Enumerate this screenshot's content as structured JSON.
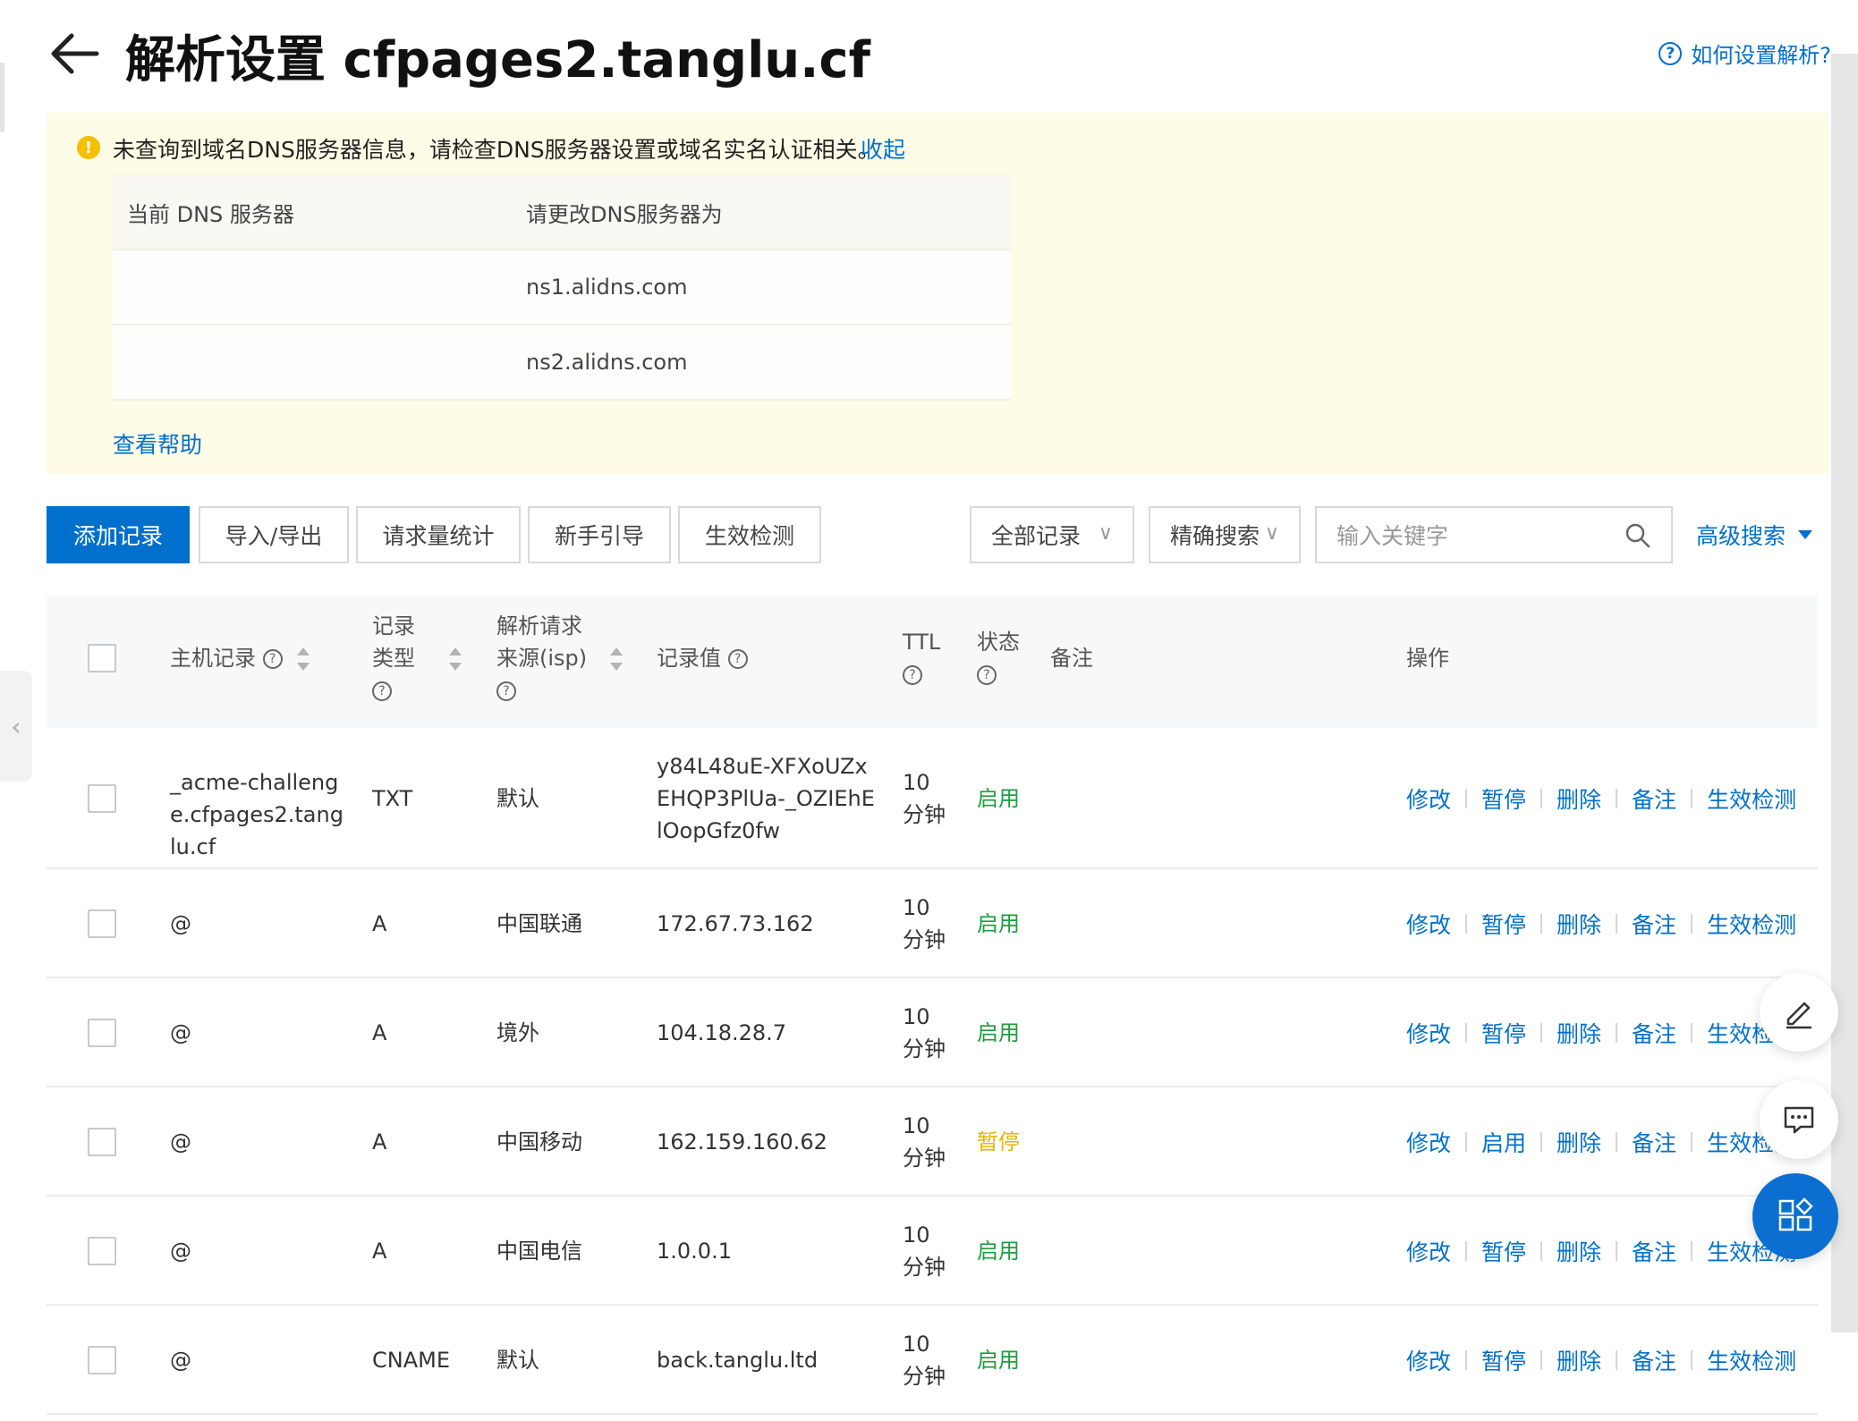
{
  "header": {
    "title": "解析设置 cfpages2.tanglu.cf",
    "help_link": "如何设置解析?"
  },
  "notice": {
    "message": "未查询到域名DNS服务器信息，请检查DNS服务器设置或域名实名认证相关。",
    "collapse": "收起",
    "table_headers": [
      "当前 DNS 服务器",
      "请更改DNS服务器为"
    ],
    "rows": [
      {
        "current": "",
        "target": "ns1.alidns.com"
      },
      {
        "current": "",
        "target": "ns2.alidns.com"
      }
    ],
    "help": "查看帮助"
  },
  "toolbar": {
    "add_record": "添加记录",
    "import_export": "导入/导出",
    "request_stats": "请求量统计",
    "guide": "新手引导",
    "effect_check": "生效检测",
    "record_filter": "全部记录",
    "search_mode": "精确搜索",
    "search_placeholder": "输入关键字",
    "advanced_search": "高级搜索"
  },
  "table": {
    "headers": {
      "host": "主机记录",
      "type_line1": "记录",
      "type_line2": "类型",
      "isp_line1": "解析请求",
      "isp_line2": "来源(isp)",
      "value": "记录值",
      "ttl": "TTL",
      "status": "状态",
      "note": "备注",
      "ops": "操作"
    },
    "rows": [
      {
        "host": "_acme-challenge.cfpages2.tanglu.cf",
        "type": "TXT",
        "isp": "默认",
        "value": "y84L48uE-XFXoUZxEHQP3PlUa-_OZIEhElOopGfz0fw",
        "ttl_value": "10",
        "ttl_unit": "分钟",
        "status": "启用",
        "status_kind": "on",
        "ops": [
          "修改",
          "暂停",
          "删除",
          "备注",
          "生效检测"
        ]
      },
      {
        "host": "@",
        "type": "A",
        "isp": "中国联通",
        "value": "172.67.73.162",
        "ttl_value": "10",
        "ttl_unit": "分钟",
        "status": "启用",
        "status_kind": "on",
        "ops": [
          "修改",
          "暂停",
          "删除",
          "备注",
          "生效检测"
        ]
      },
      {
        "host": "@",
        "type": "A",
        "isp": "境外",
        "value": "104.18.28.7",
        "ttl_value": "10",
        "ttl_unit": "分钟",
        "status": "启用",
        "status_kind": "on",
        "ops": [
          "修改",
          "暂停",
          "删除",
          "备注",
          "生效检测"
        ]
      },
      {
        "host": "@",
        "type": "A",
        "isp": "中国移动",
        "value": "162.159.160.62",
        "ttl_value": "10",
        "ttl_unit": "分钟",
        "status": "暂停",
        "status_kind": "paused",
        "ops": [
          "修改",
          "启用",
          "删除",
          "备注",
          "生效检测"
        ]
      },
      {
        "host": "@",
        "type": "A",
        "isp": "中国电信",
        "value": "1.0.0.1",
        "ttl_value": "10",
        "ttl_unit": "分钟",
        "status": "启用",
        "status_kind": "on",
        "ops": [
          "修改",
          "暂停",
          "删除",
          "备注",
          "生效检测"
        ]
      },
      {
        "host": "@",
        "type": "CNAME",
        "isp": "默认",
        "value": "back.tanglu.ltd",
        "ttl_value": "10",
        "ttl_unit": "分钟",
        "status": "启用",
        "status_kind": "on",
        "ops": [
          "修改",
          "暂停",
          "删除",
          "备注",
          "生效检测"
        ]
      }
    ]
  },
  "colors": {
    "accent": "#0070cc",
    "status_on": "#1b9e3e",
    "status_paused": "#e3b500",
    "notice_bg": "#fefbe6"
  },
  "icons": {
    "back": "arrow-left-icon",
    "help": "question-circle-icon",
    "warning": "exclamation-circle-icon",
    "search": "search-icon",
    "edit_widget": "pencil-icon",
    "chat_widget": "chat-bubble-icon",
    "apps_widget": "apps-grid-icon"
  }
}
